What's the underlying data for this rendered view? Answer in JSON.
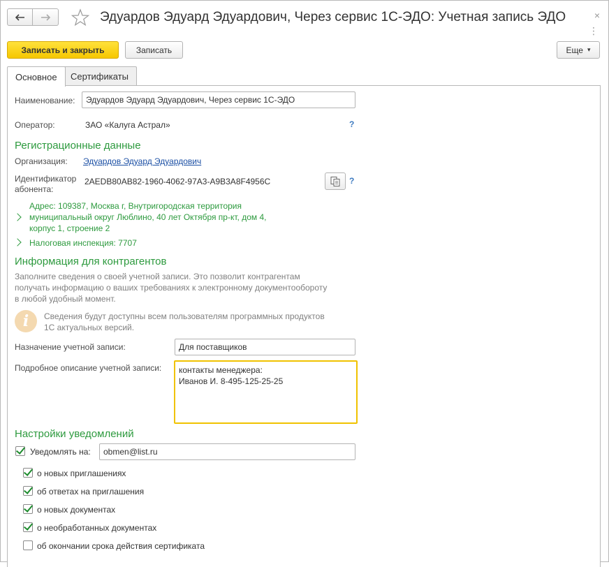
{
  "window": {
    "title": "Эдуардов Эдуард Эдуардович, Через сервис 1С-ЭДО: Учетная запись ЭДО",
    "close_glyph": "×",
    "more_glyph": "⋮"
  },
  "toolbar": {
    "save_close_label": "Записать и закрыть",
    "save_label": "Записать",
    "more_label": "Еще",
    "more_arrow": "▾"
  },
  "tabs": [
    {
      "label": "Основное",
      "active": true
    },
    {
      "label": "Сертификаты",
      "active": false
    }
  ],
  "main": {
    "name_label": "Наименование:",
    "name_value": "Эдуардов Эдуард Эдуардович, Через сервис 1С-ЭДО",
    "operator_label": "Оператор:",
    "operator_value": "ЗАО «Калуга Астрал»",
    "help_glyph": "?"
  },
  "registration": {
    "heading": "Регистрационные данные",
    "org_label": "Организация:",
    "org_value": "Эдуардов Эдуард Эдуардович",
    "subscriber_label_line1": "Идентификатор",
    "subscriber_label_line2": "абонента:",
    "subscriber_value": "2AEDB80AB82-1960-4062-97A3-A9B3A8F4956C",
    "address_lines": [
      "Адрес: 109387, Москва г, Внутригородская территория",
      "муниципальный округ Люблино, 40 лет Октября пр-кт, дом 4,",
      "корпус 1, строение 2"
    ],
    "tax_office": "Налоговая инспекция: 7707"
  },
  "counterparty_info": {
    "heading": "Информация для контрагентов",
    "description_lines": [
      "Заполните сведения о своей учетной записи. Это позволит контрагентам",
      "получать информацию о ваших требованиях к электронному документообороту",
      "в любой удобный момент."
    ],
    "notice_lines": [
      "Сведения будут доступны всем пользователям программных продуктов",
      "1С актуальных версий."
    ],
    "info_glyph": "i",
    "purpose_label": "Назначение учетной записи:",
    "purpose_value": "Для поставщиков",
    "detail_label": "Подробное описание учетной записи:",
    "detail_value": "контакты менеджера:\nИванов И. 8-495-125-25-25"
  },
  "notifications": {
    "heading": "Настройки уведомлений",
    "notify_label": "Уведомлять на:",
    "notify_checked": true,
    "email": "obmen@list.ru",
    "options": [
      {
        "label": "о новых приглашениях",
        "checked": true
      },
      {
        "label": "об ответах на приглашения",
        "checked": true
      },
      {
        "label": "о новых документах",
        "checked": true
      },
      {
        "label": "о необработанных документах",
        "checked": true
      },
      {
        "label": "об окончании срока действия сертификата",
        "checked": false
      }
    ]
  },
  "colors": {
    "accent_green": "#2d9a3e",
    "primary_button": "#f6c700",
    "link": "#1b4fa4",
    "focus_border": "#f0c200"
  },
  "icons": [
    "back-arrow-icon",
    "forward-arrow-icon",
    "star-icon",
    "close-icon",
    "more-icon",
    "copy-icon",
    "help-icon",
    "chevron-right-icon",
    "info-icon",
    "checkbox-icon"
  ]
}
